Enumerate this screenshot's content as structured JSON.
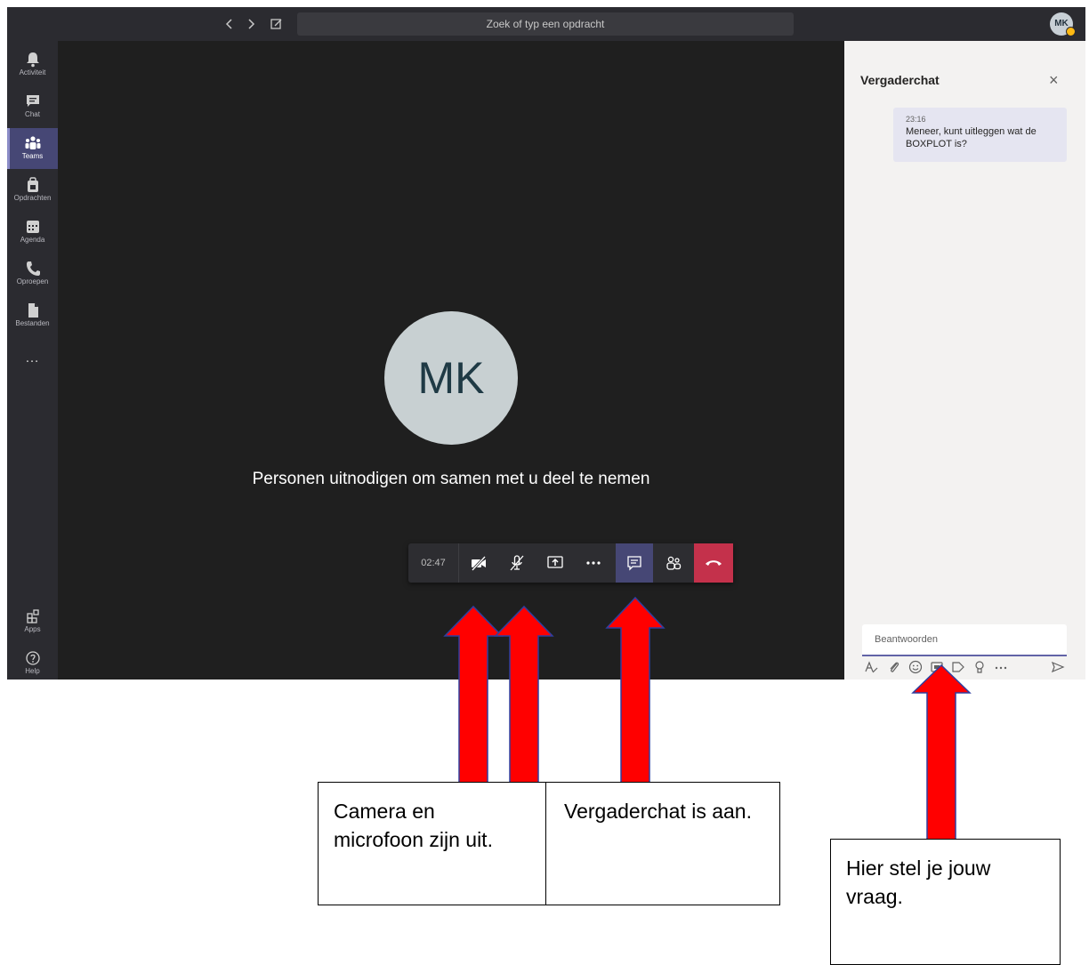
{
  "topbar": {
    "back_icon": "chevron-left-icon",
    "forward_icon": "chevron-right-icon",
    "compose_icon": "new-chat-icon",
    "search_placeholder": "Zoek of typ een opdracht",
    "avatar_initials": "MK"
  },
  "rail": {
    "items": [
      {
        "label": "Activiteit",
        "icon": "bell-icon"
      },
      {
        "label": "Chat",
        "icon": "chat-icon"
      },
      {
        "label": "Teams",
        "icon": "teams-icon",
        "active": true
      },
      {
        "label": "Opdrachten",
        "icon": "assignments-icon"
      },
      {
        "label": "Agenda",
        "icon": "calendar-icon"
      },
      {
        "label": "Oproepen",
        "icon": "phone-icon"
      },
      {
        "label": "Bestanden",
        "icon": "file-icon"
      }
    ],
    "more": "…",
    "apps_label": "Apps",
    "help_label": "Help"
  },
  "stage": {
    "avatar_initials": "MK",
    "invite_text": "Personen uitnodigen om samen met u deel te nemen"
  },
  "callbar": {
    "timer": "02:47",
    "buttons": [
      "camera-off-icon",
      "mic-off-icon",
      "share-screen-icon",
      "more-icon",
      "chat-icon",
      "participants-icon",
      "hang-up-icon"
    ]
  },
  "chat": {
    "title": "Vergaderchat",
    "close": "×",
    "message": {
      "time": "23:16",
      "text": "Meneer, kunt uitleggen wat de BOXPLOT is?"
    },
    "reply_placeholder": "Beantwoorden",
    "compose_icons": [
      "format-icon",
      "attach-icon",
      "emoji-icon",
      "gif-icon",
      "sticker-icon",
      "praise-icon",
      "more-icon",
      "send-icon"
    ]
  },
  "annotations": {
    "callout1": "Camera en microfoon zijn uit.",
    "callout2": "Vergaderchat is aan.",
    "callout3": "Hier stel je jouw vraag.",
    "arrow_color": "#ff0000",
    "arrow_outline": "#2f3f9f"
  }
}
